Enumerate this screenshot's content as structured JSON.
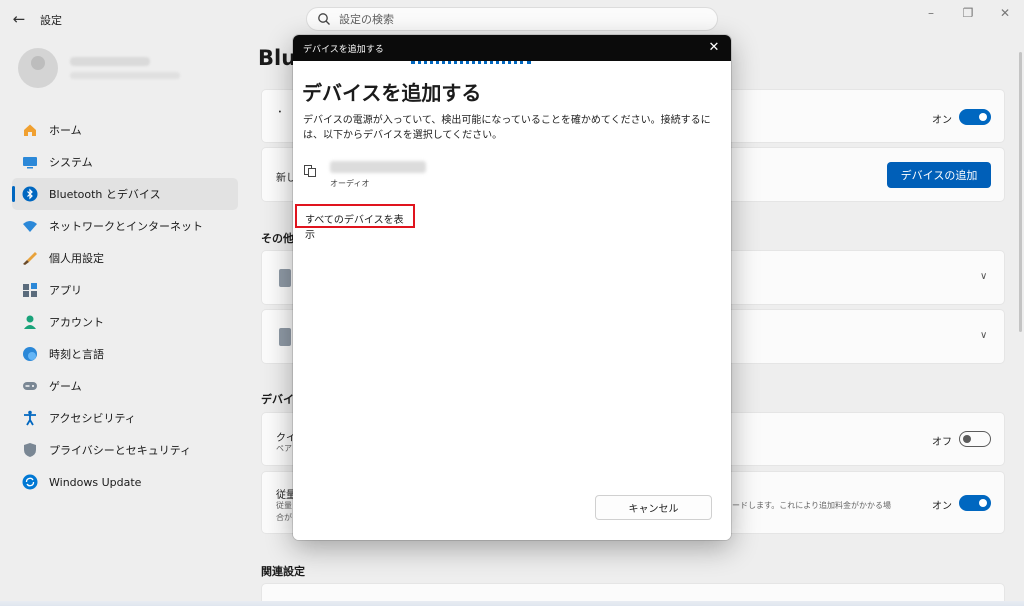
{
  "window": {
    "title": "設定",
    "back_icon": "back-arrow-icon",
    "controls": [
      "minimize-icon",
      "maximize-icon",
      "close-icon"
    ]
  },
  "search": {
    "placeholder": "設定の検索",
    "icon": "search-icon"
  },
  "sidebar": {
    "items": [
      {
        "label": "ホーム",
        "icon": "home-icon"
      },
      {
        "label": "システム",
        "icon": "system-icon"
      },
      {
        "label": "Bluetooth とデバイス",
        "icon": "bluetooth-icon",
        "active": true
      },
      {
        "label": "ネットワークとインターネット",
        "icon": "wifi-icon"
      },
      {
        "label": "個人用設定",
        "icon": "brush-icon"
      },
      {
        "label": "アプリ",
        "icon": "apps-icon"
      },
      {
        "label": "アカウント",
        "icon": "account-icon"
      },
      {
        "label": "時刻と言語",
        "icon": "globe-icon"
      },
      {
        "label": "ゲーム",
        "icon": "gamepad-icon"
      },
      {
        "label": "アクセシビリティ",
        "icon": "accessibility-icon"
      },
      {
        "label": "プライバシーとセキュリティ",
        "icon": "shield-icon"
      },
      {
        "label": "Windows Update",
        "icon": "update-icon"
      }
    ]
  },
  "main": {
    "title_visible": "Blu",
    "bluetooth_toggle_label": "オン",
    "new_device_text_visible": "新し",
    "add_device_button": "デバイスの追加",
    "other_devices_heading_visible": "その他の",
    "device_settings_heading_visible": "デバイス",
    "swift_pair_text_visible": "クイ",
    "swift_pair_sub_visible": "ペア",
    "swift_pair_toggle_label": "オフ",
    "metered_text_visible": "従量",
    "metered_sub1_visible": "従量",
    "metered_sub1_right": "ウンロードします。これにより追加料金がかかる場",
    "metered_sub2_visible": "合が",
    "metered_toggle_label": "オン",
    "related_heading": "関連設定",
    "accent_color": "#0067c0"
  },
  "dialog": {
    "bar_title": "デバイスを追加する",
    "heading": "デバイスを追加する",
    "description": "デバイスの電源が入っていて、検出可能になっていることを確かめてください。接続するには、以下からデバイスを選択してください。",
    "device_type": "オーディオ",
    "show_all_link": "すべてのデバイスを表示",
    "cancel_button": "キャンセル",
    "highlight_color": "#e0141e"
  }
}
